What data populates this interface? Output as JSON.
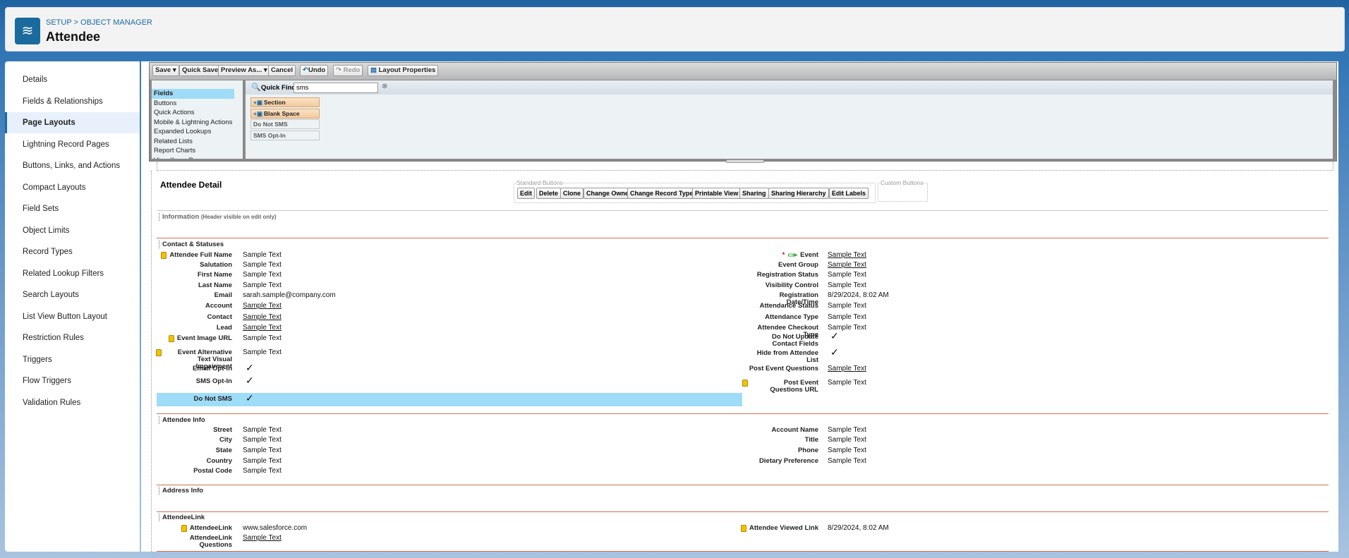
{
  "header": {
    "breadcrumb": "SETUP > OBJECT MANAGER",
    "title": "Attendee",
    "icon": "layers-icon"
  },
  "sidebar": {
    "items": [
      "Details",
      "Fields & Relationships",
      "Page Layouts",
      "Lightning Record Pages",
      "Buttons, Links, and Actions",
      "Compact Layouts",
      "Field Sets",
      "Object Limits",
      "Record Types",
      "Related Lookup Filters",
      "Search Layouts",
      "List View Button Layout",
      "Restriction Rules",
      "Triggers",
      "Flow Triggers",
      "Validation Rules"
    ],
    "selected": "Page Layouts"
  },
  "toolbar": {
    "save": "Save",
    "quick_save": "Quick Save",
    "preview_as": "Preview As...",
    "cancel": "Cancel",
    "undo": "Undo",
    "redo": "Redo",
    "layout_properties": "Layout Properties"
  },
  "palette": {
    "categories": [
      "Fields",
      "Buttons",
      "Quick Actions",
      "Mobile & Lightning Actions",
      "Expanded Lookups",
      "Related Lists",
      "Report Charts",
      "Visualforce Pages"
    ],
    "selected": "Fields",
    "quick_find_label": "Quick Find",
    "quick_find_value": "sms",
    "items": [
      "Section",
      "Blank Space",
      "Do Not SMS",
      "SMS Opt-In"
    ]
  },
  "detail": {
    "title": "Attendee Detail",
    "standard_buttons_label": "Standard Buttons",
    "custom_buttons_label": "Custom Buttons",
    "standard_buttons": [
      "Edit",
      "Delete",
      "Clone",
      "Change Owner",
      "Change Record Type",
      "Printable View",
      "Sharing",
      "Sharing Hierarchy",
      "Edit Labels"
    ],
    "information": {
      "title": "Information",
      "note": "(Header visible on edit only)"
    },
    "sections": [
      {
        "title": "Contact & Statuses",
        "left": [
          {
            "label": "Attendee Full Name",
            "value": "Sample Text",
            "lock": true
          },
          {
            "label": "Salutation",
            "value": "Sample Text"
          },
          {
            "label": "First Name",
            "value": "Sample Text"
          },
          {
            "label": "Last Name",
            "value": "Sample Text"
          },
          {
            "label": "Email",
            "value": "sarah.sample@company.com"
          },
          {
            "label": "Account",
            "value": "Sample Text",
            "link": true
          },
          {
            "label": "Contact",
            "value": "Sample Text",
            "link": true
          },
          {
            "label": "Lead",
            "value": "Sample Text",
            "link": true
          },
          {
            "label": "Event Image URL",
            "value": "Sample Text",
            "lock": true
          },
          {
            "label": "Event Alternative Text Visual Impairment",
            "value": "Sample Text",
            "lock": true
          },
          {
            "label": "Email Opt-In",
            "value": "✓",
            "check": true
          },
          {
            "label": "SMS Opt-In",
            "value": "✓",
            "check": true
          },
          {
            "label": "Do Not SMS",
            "value": "✓",
            "check": true,
            "highlight": true
          }
        ],
        "right": [
          {
            "label": "Event",
            "value": "Sample Text",
            "link": true,
            "required": true
          },
          {
            "label": "Event Group",
            "value": "Sample Text",
            "link": true
          },
          {
            "label": "Registration Status",
            "value": "Sample Text"
          },
          {
            "label": "Visibility Control",
            "value": "Sample Text"
          },
          {
            "label": "Registration Date/Time",
            "value": "8/29/2024, 8:02 AM"
          },
          {
            "label": "Attendance Status",
            "value": "Sample Text"
          },
          {
            "label": "Attendance Type",
            "value": "Sample Text"
          },
          {
            "label": "Attendee Checkout Type",
            "value": "Sample Text"
          },
          {
            "label": "Do Not Update Contact Fields",
            "value": "✓",
            "check": true
          },
          {
            "label": "Hide from Attendee List",
            "value": "✓",
            "check": true
          },
          {
            "label": "Post Event Questions",
            "value": "Sample Text",
            "link": true
          },
          {
            "label": "Post Event Questions URL",
            "value": "Sample Text",
            "lock": true
          }
        ]
      },
      {
        "title": "Attendee Info",
        "left": [
          {
            "label": "Street",
            "value": "Sample Text"
          },
          {
            "label": "City",
            "value": "Sample Text"
          },
          {
            "label": "State",
            "value": "Sample Text"
          },
          {
            "label": "Country",
            "value": "Sample Text"
          },
          {
            "label": "Postal Code",
            "value": "Sample Text"
          }
        ],
        "right": [
          {
            "label": "Account Name",
            "value": "Sample Text"
          },
          {
            "label": "Title",
            "value": "Sample Text"
          },
          {
            "label": "Phone",
            "value": "Sample Text"
          },
          {
            "label": "Dietary Preference",
            "value": "Sample Text"
          }
        ]
      },
      {
        "title": "Address Info",
        "left": [],
        "right": []
      },
      {
        "title": "AttendeeLink",
        "left": [
          {
            "label": "AttendeeLink",
            "value": "www.salesforce.com",
            "lock": true
          },
          {
            "label": "AttendeeLink Questions",
            "value": "Sample Text",
            "link": true
          }
        ],
        "right": [
          {
            "label": "Attendee Viewed Link",
            "value": "8/29/2024, 8:02 AM",
            "lock": true
          }
        ]
      }
    ]
  },
  "colors": {
    "brand": "#1b6a9e",
    "section_line": "#d0714d",
    "highlight": "#9fdcf7"
  }
}
